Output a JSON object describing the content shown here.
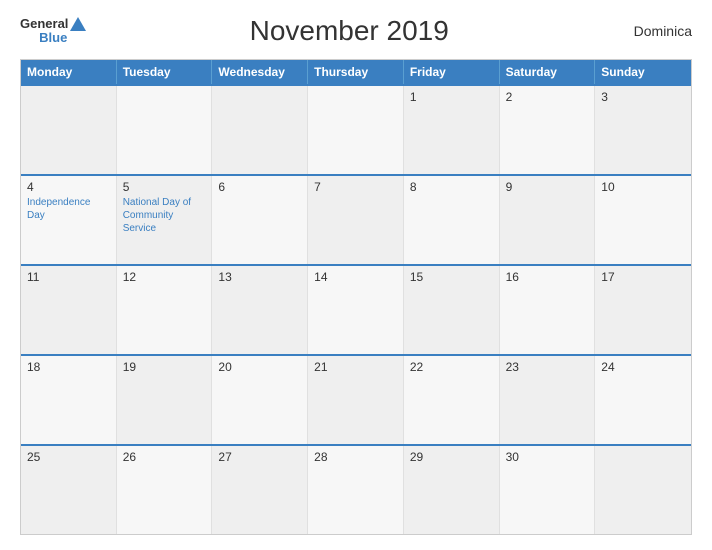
{
  "header": {
    "logo": {
      "general": "General",
      "blue": "Blue"
    },
    "title": "November 2019",
    "country": "Dominica"
  },
  "days_of_week": [
    "Monday",
    "Tuesday",
    "Wednesday",
    "Thursday",
    "Friday",
    "Saturday",
    "Sunday"
  ],
  "weeks": [
    [
      {
        "day": "",
        "event": ""
      },
      {
        "day": "",
        "event": ""
      },
      {
        "day": "",
        "event": ""
      },
      {
        "day": "",
        "event": ""
      },
      {
        "day": "1",
        "event": ""
      },
      {
        "day": "2",
        "event": ""
      },
      {
        "day": "3",
        "event": ""
      }
    ],
    [
      {
        "day": "4",
        "event": "Independence Day"
      },
      {
        "day": "5",
        "event": "National Day of Community Service"
      },
      {
        "day": "6",
        "event": ""
      },
      {
        "day": "7",
        "event": ""
      },
      {
        "day": "8",
        "event": ""
      },
      {
        "day": "9",
        "event": ""
      },
      {
        "day": "10",
        "event": ""
      }
    ],
    [
      {
        "day": "11",
        "event": ""
      },
      {
        "day": "12",
        "event": ""
      },
      {
        "day": "13",
        "event": ""
      },
      {
        "day": "14",
        "event": ""
      },
      {
        "day": "15",
        "event": ""
      },
      {
        "day": "16",
        "event": ""
      },
      {
        "day": "17",
        "event": ""
      }
    ],
    [
      {
        "day": "18",
        "event": ""
      },
      {
        "day": "19",
        "event": ""
      },
      {
        "day": "20",
        "event": ""
      },
      {
        "day": "21",
        "event": ""
      },
      {
        "day": "22",
        "event": ""
      },
      {
        "day": "23",
        "event": ""
      },
      {
        "day": "24",
        "event": ""
      }
    ],
    [
      {
        "day": "25",
        "event": ""
      },
      {
        "day": "26",
        "event": ""
      },
      {
        "day": "27",
        "event": ""
      },
      {
        "day": "28",
        "event": ""
      },
      {
        "day": "29",
        "event": ""
      },
      {
        "day": "30",
        "event": ""
      },
      {
        "day": "",
        "event": ""
      }
    ]
  ]
}
